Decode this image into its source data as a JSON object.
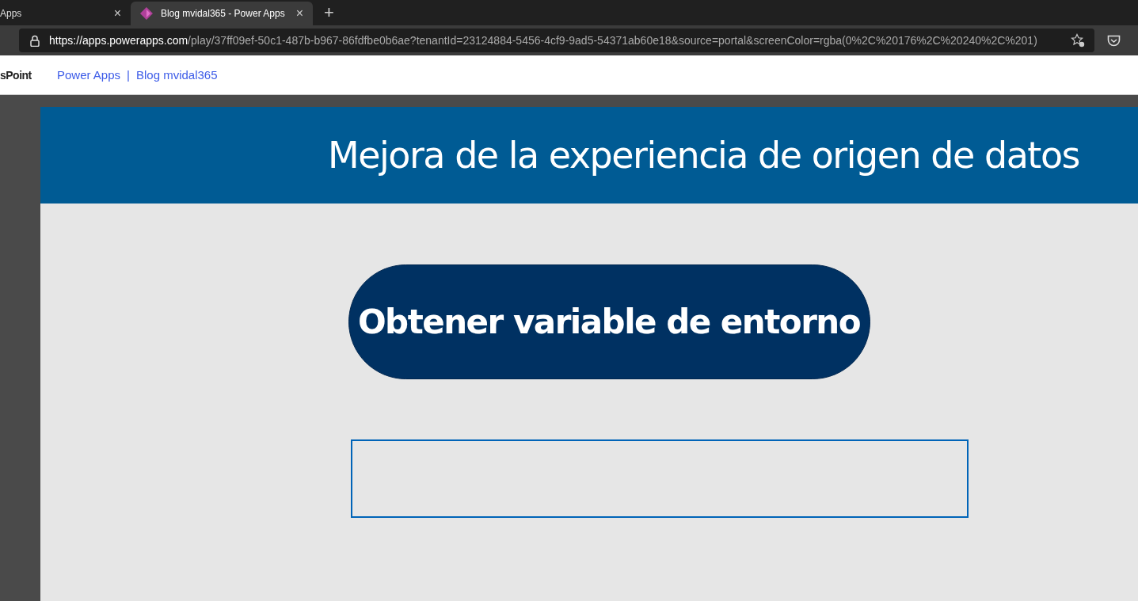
{
  "browser": {
    "tabs": [
      {
        "label": "Apps",
        "selected": false,
        "close": "×"
      },
      {
        "label": "Blog mvidal365 - Power Apps",
        "selected": true,
        "close": "×"
      }
    ],
    "new_tab": "+",
    "address": {
      "host": "https://apps.powerapps.com",
      "path": "/play/37ff09ef-50c1-487b-b967-86fdfbe0b6ae?tenantId=23124884-5456-4cf9-9ad5-54371ab60e18&source=portal&screenColor=rgba(0%2C%20176%2C%20240%2C%201)"
    }
  },
  "site_nav": {
    "brand": "sPoint",
    "links": [
      "Power Apps",
      "Blog mvidal365"
    ],
    "separator": "|"
  },
  "app": {
    "title": "Mejora de la experiencia de origen de datos",
    "button": "Obtener variable de entorno"
  }
}
